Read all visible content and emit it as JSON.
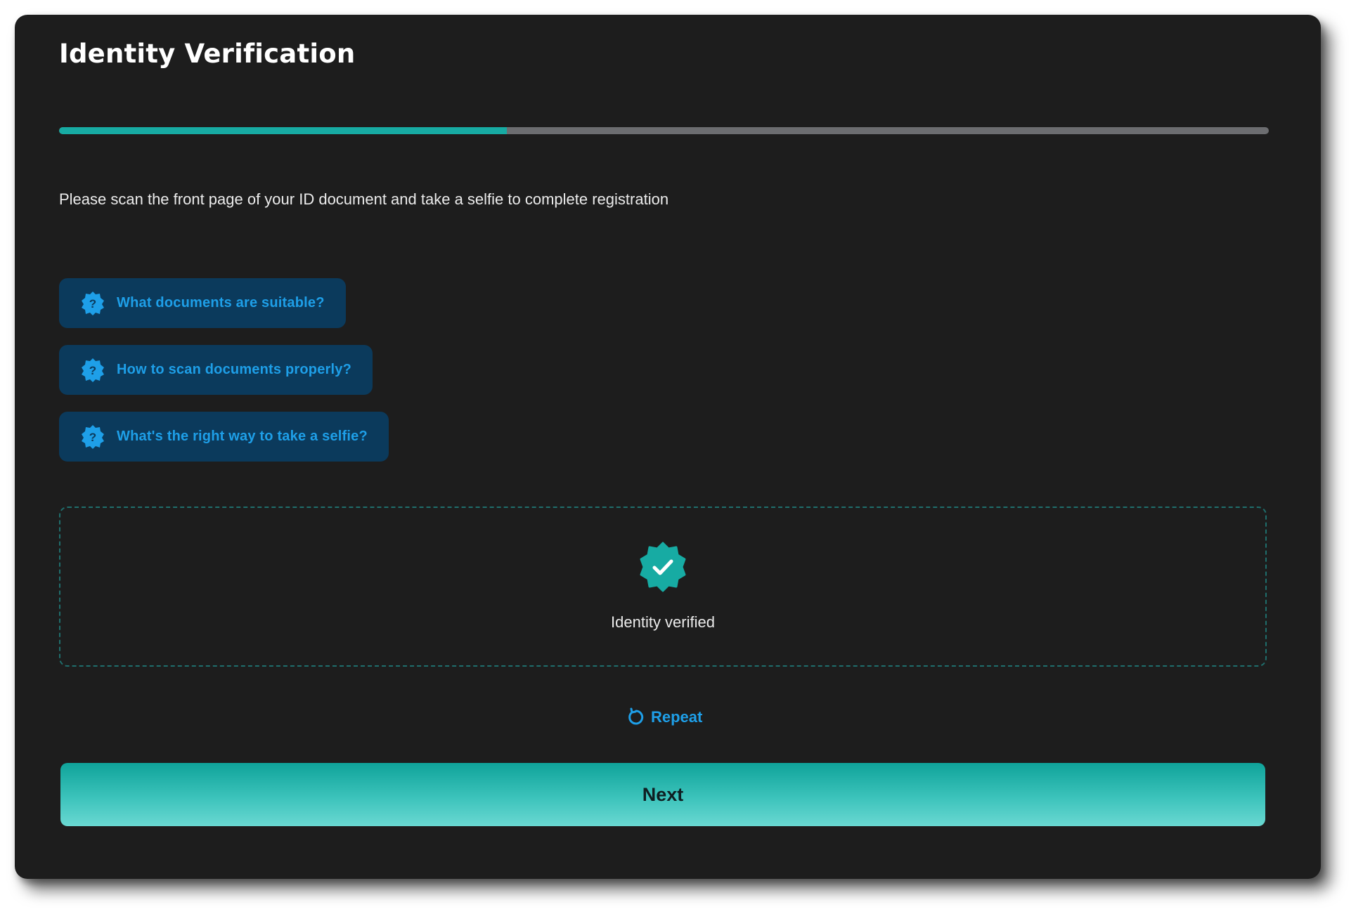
{
  "header": {
    "title": "Identity Verification"
  },
  "progress": {
    "value": 0.37
  },
  "instructions": "Please scan the front page of your ID document and take a selfie to complete registration",
  "help_links": [
    {
      "label": "What documents are suitable?",
      "icon": "question-badge-icon"
    },
    {
      "label": "How to scan documents properly?",
      "icon": "question-badge-icon"
    },
    {
      "label": "What's the right way to take a selfie?",
      "icon": "question-badge-icon"
    }
  ],
  "status": {
    "label": "Identity verified",
    "icon": "verified-badge-icon"
  },
  "repeat": {
    "label": "Repeat",
    "icon": "refresh-icon"
  },
  "next_button": {
    "label": "Next"
  },
  "colors": {
    "background": "#1d1d1d",
    "accent_teal": "#17aba3",
    "link_blue": "#1e9fe8",
    "help_button_bg": "#0b3a5c",
    "progress_track": "#6c6d70"
  }
}
